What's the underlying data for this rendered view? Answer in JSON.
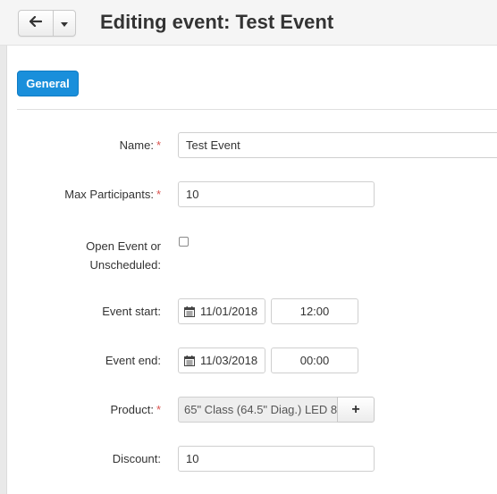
{
  "header": {
    "title": "Editing event: Test Event",
    "back_icon": "arrow-left-icon",
    "dropdown_icon": "caret-down-icon"
  },
  "tabs": [
    {
      "label": "General",
      "active": true
    }
  ],
  "form": {
    "name": {
      "label": "Name:",
      "required": true,
      "value": "Test Event"
    },
    "max_participants": {
      "label": "Max Participants:",
      "required": true,
      "value": "10"
    },
    "open_event": {
      "label_line1": "Open Event or",
      "label_line2": "Unscheduled:",
      "checked": false
    },
    "event_start": {
      "label": "Event start:",
      "date": "11/01/2018",
      "time": "12:00"
    },
    "event_end": {
      "label": "Event end:",
      "date": "11/03/2018",
      "time": "00:00"
    },
    "product": {
      "label": "Product:",
      "required": true,
      "value": "65\" Class (64.5\" Diag.) LED 8",
      "add_label": "+"
    },
    "discount": {
      "label": "Discount:",
      "value": "10"
    }
  },
  "colors": {
    "accent": "#1a8fdb",
    "required": "#d9534f"
  }
}
